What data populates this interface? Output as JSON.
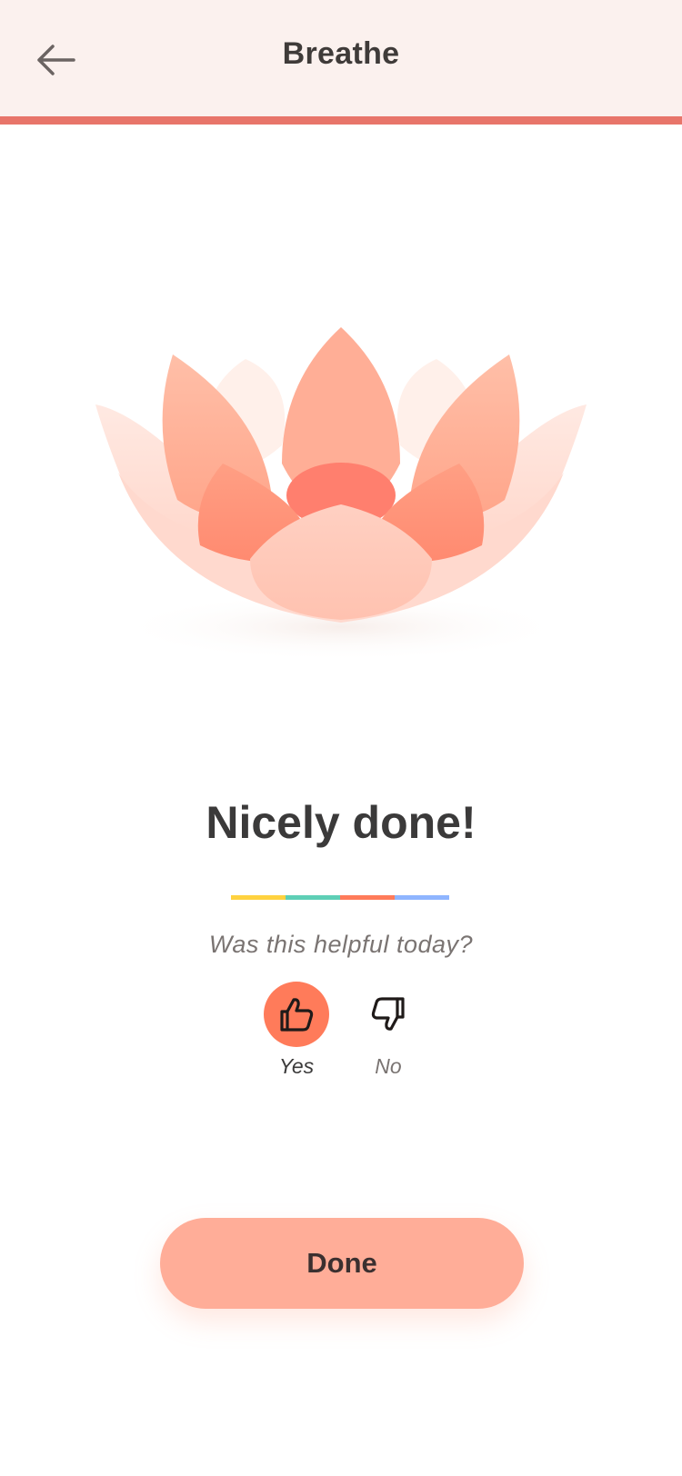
{
  "header": {
    "back_icon": "arrow-left-icon",
    "title": "Breathe",
    "bg_color": "#fbf1ee",
    "accent_bar_color": "#e8756a"
  },
  "illustration": {
    "icon": "lotus-flower-illustration"
  },
  "completion": {
    "headline": "Nicely done!",
    "stripe_colors": [
      "#ffd23f",
      "#5ecfb6",
      "#ff7b5a",
      "#8fb5ff"
    ]
  },
  "feedback": {
    "question": "Was this helpful today?",
    "yes_label": "Yes",
    "yes_icon": "thumbs-up-icon",
    "yes_selected": true,
    "yes_color": "#ff7b5a",
    "no_label": "No",
    "no_icon": "thumbs-down-icon"
  },
  "actions": {
    "done_label": "Done",
    "done_color": "#ffad98"
  }
}
